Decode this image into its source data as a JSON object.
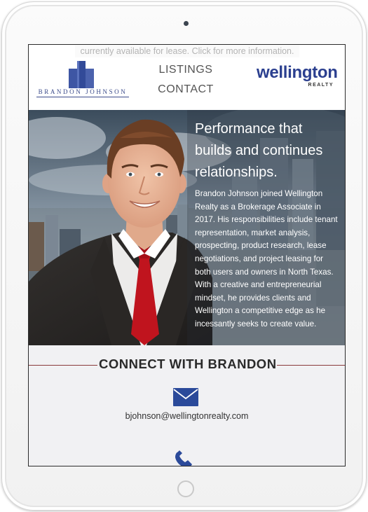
{
  "notice": {
    "text": "currently available for lease. Click for more information."
  },
  "header": {
    "agent_logo_text": "BRANDON JOHNSON",
    "nav": {
      "listings": "LISTINGS",
      "contact": "CONTACT"
    },
    "company_logo": {
      "word": "wellington",
      "sub": "REALTY"
    }
  },
  "hero": {
    "title": "Performance that builds and continues relationships.",
    "body": "Brandon Johnson joined Wellington Realty as a Brokerage Associate in 2017. His responsibilities include tenant representation, market analysis, prospecting, product research, lease negotiations, and project leasing for both users and owners in North Texas. With a creative and entrepreneurial mindset, he provides clients and Wellington a competitive edge as he incessantly seeks to create value."
  },
  "connect": {
    "title": "CONNECT WITH BRANDON",
    "email": "bjohnson@wellingtonrealty.com",
    "icons": [
      "envelope-icon",
      "phone-icon"
    ]
  },
  "colors": {
    "brand_blue": "#2b3f8f",
    "envelope_blue": "#2b4a9a",
    "tie_red": "#c0141e",
    "rule_red": "#8a3a3a"
  }
}
